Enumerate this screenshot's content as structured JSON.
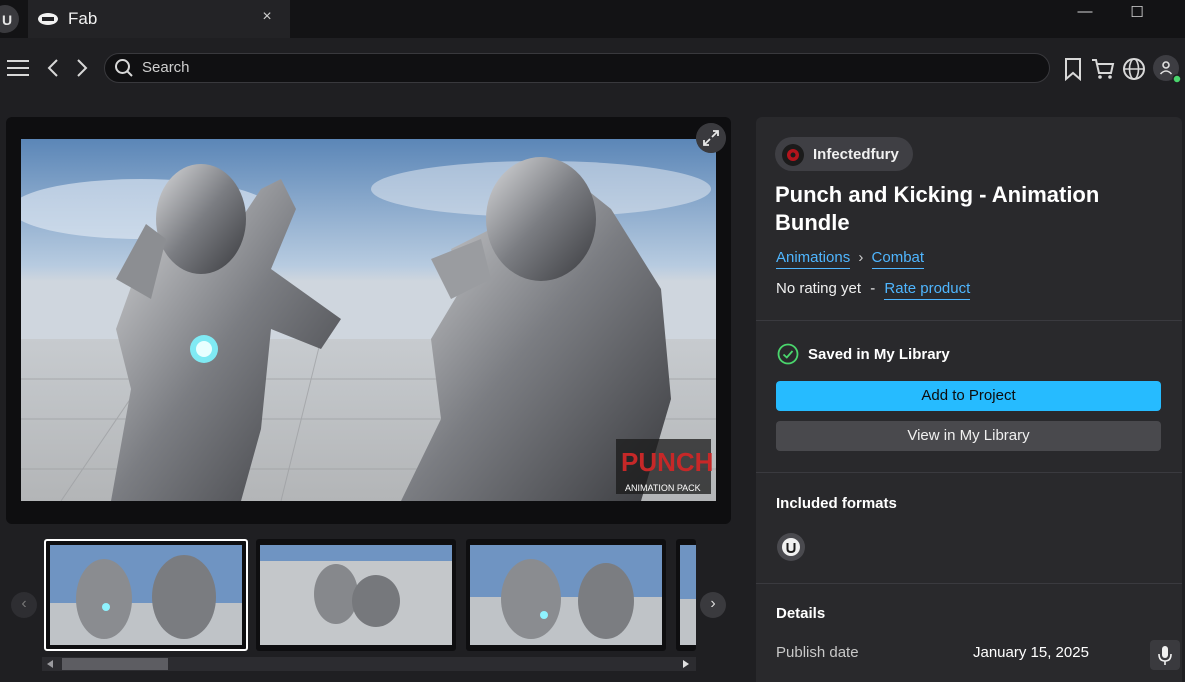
{
  "window": {
    "tab_title": "Fab",
    "tab_close": "×",
    "minimize": "—",
    "maximize": "☐"
  },
  "nav": {
    "search_placeholder": "Search"
  },
  "product": {
    "seller": "Infectedfury",
    "title": "Punch and Kicking - Animation Bundle",
    "breadcrumb": [
      "Animations",
      "Combat"
    ],
    "rating_text": "No rating yet",
    "rating_sep": "-",
    "rate_link": "Rate product",
    "watermark": "PUNCH!",
    "watermark_sub": "ANIMATION PACK"
  },
  "library": {
    "saved_label": "Saved in My Library",
    "add_button": "Add to Project",
    "view_button": "View in My Library"
  },
  "formats": {
    "heading": "Included formats"
  },
  "details": {
    "heading": "Details",
    "publish_label": "Publish date",
    "publish_value": "January 15, 2025"
  },
  "colors": {
    "accent": "#26bbff",
    "link": "#4fb6ff",
    "success": "#4ad66d",
    "panel": "#29292c"
  }
}
